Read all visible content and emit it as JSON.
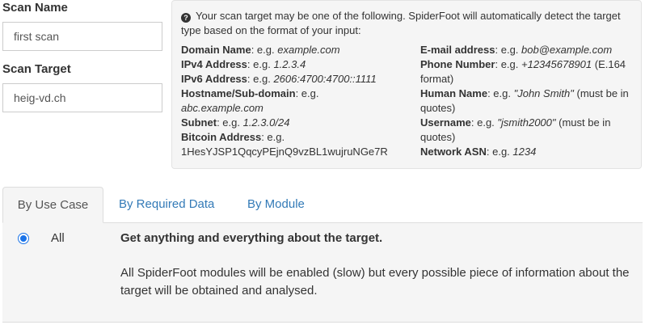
{
  "form": {
    "scan_name_label": "Scan Name",
    "scan_name_value": "first scan",
    "scan_target_label": "Scan Target",
    "scan_target_value": "heig-vd.ch"
  },
  "help": {
    "icon": "question-circle-icon",
    "intro": "Your scan target may be one of the following. SpiderFoot will automatically detect the target type based on the format of your input:",
    "left": [
      {
        "name": "Domain Name",
        "sep": ": e.g. ",
        "example": "example.com",
        "suffix": ""
      },
      {
        "name": "IPv4 Address",
        "sep": ": e.g. ",
        "example": "1.2.3.4",
        "suffix": ""
      },
      {
        "name": "IPv6 Address",
        "sep": ": e.g. ",
        "example": "2606:4700:4700::1111",
        "suffix": ""
      },
      {
        "name": "Hostname/Sub-domain",
        "sep": ": e.g. ",
        "example": "abc.example.com",
        "suffix": ""
      },
      {
        "name": "Subnet",
        "sep": ": e.g. ",
        "example": "1.2.3.0/24",
        "suffix": ""
      },
      {
        "name": "Bitcoin Address",
        "sep": ": e.g. ",
        "example": "1HesYJSP1QqcyPEjnQ9vzBL1wujruNGe7R",
        "suffix": ""
      }
    ],
    "right": [
      {
        "name": "E-mail address",
        "sep": ": e.g. ",
        "example": "bob@example.com",
        "suffix": ""
      },
      {
        "name": "Phone Number",
        "sep": ": e.g. ",
        "example": "+12345678901",
        "suffix": " (E.164 format)"
      },
      {
        "name": "Human Name",
        "sep": ": e.g. ",
        "example": "\"John Smith\"",
        "suffix": " (must be in quotes)"
      },
      {
        "name": "Username",
        "sep": ": e.g. ",
        "example": "\"jsmith2000\"",
        "suffix": " (must be in quotes)"
      },
      {
        "name": "Network ASN",
        "sep": ": e.g. ",
        "example": "1234",
        "suffix": ""
      }
    ]
  },
  "tabs": [
    {
      "label": "By Use Case",
      "active": true
    },
    {
      "label": "By Required Data",
      "active": false
    },
    {
      "label": "By Module",
      "active": false
    }
  ],
  "use_case": {
    "option_label": "All",
    "selected": true,
    "title": "Get anything and everything about the target.",
    "description": "All SpiderFoot modules will be enabled (slow) but every possible piece of information about the target will be obtained and analysed."
  },
  "colors": {
    "link": "#337ab7",
    "panel_bg": "#f5f5f5",
    "radio": "#1a73e8"
  }
}
